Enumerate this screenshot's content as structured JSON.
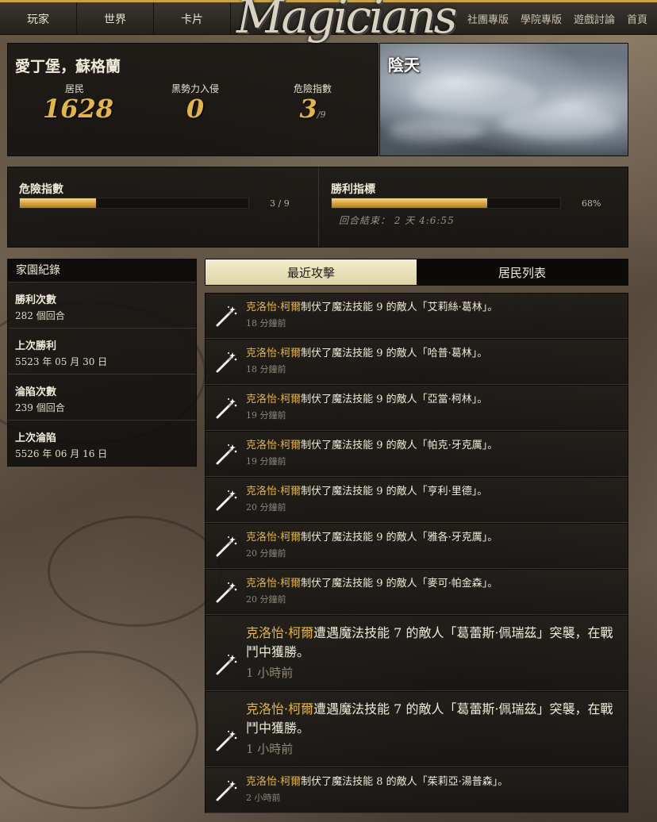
{
  "nav": {
    "left": [
      "玩家",
      "世界",
      "卡片"
    ],
    "logo": "Magicians",
    "right": [
      "社團專版",
      "學院專版",
      "遊戲討論",
      "首頁"
    ]
  },
  "city": {
    "title": "愛丁堡，蘇格蘭",
    "residents_label": "居民",
    "residents_value": "1628",
    "invasion_label": "黑勢力入侵",
    "invasion_value": "0",
    "danger_label": "危險指數",
    "danger_value": "3",
    "danger_max": "/9"
  },
  "weather": {
    "label": "陰天"
  },
  "danger_bar": {
    "title": "危險指數",
    "value_text": "3 / 9",
    "fraction": 0.3333
  },
  "victory_bar": {
    "title": "勝利指標",
    "value_text": "68%",
    "fraction": 0.68,
    "round_end": "回合結束： 2 天 4:6:55"
  },
  "record": {
    "header": "家園紀錄",
    "items": [
      {
        "k": "勝利次數",
        "v": "282 個回合"
      },
      {
        "k": "上次勝利",
        "v": "5523 年 05 月 30 日"
      },
      {
        "k": "淪陷次數",
        "v": "239 個回合"
      },
      {
        "k": "上次淪陷",
        "v": "5526 年 06 月 16 日"
      }
    ]
  },
  "tabs": {
    "recent": "最近攻擊",
    "residents": "居民列表"
  },
  "feed": [
    {
      "size": "small",
      "actor": "克洛怡·柯爾",
      "rest": "制伏了魔法技能 9 的敵人「艾莉絲·葛林」。",
      "time": "18 分鐘前"
    },
    {
      "size": "small",
      "actor": "克洛怡·柯爾",
      "rest": "制伏了魔法技能 9 的敵人「哈普·葛林」。",
      "time": "18 分鐘前"
    },
    {
      "size": "small",
      "actor": "克洛怡·柯爾",
      "rest": "制伏了魔法技能 9 的敵人「亞當·柯林」。",
      "time": "19 分鐘前"
    },
    {
      "size": "small",
      "actor": "克洛怡·柯爾",
      "rest": "制伏了魔法技能 9 的敵人「帕克·牙克厲」。",
      "time": "19 分鐘前"
    },
    {
      "size": "small",
      "actor": "克洛怡·柯爾",
      "rest": "制伏了魔法技能 9 的敵人「亨利·里德」。",
      "time": "20 分鐘前"
    },
    {
      "size": "small",
      "actor": "克洛怡·柯爾",
      "rest": "制伏了魔法技能 9 的敵人「雅各·牙克厲」。",
      "time": "20 分鐘前"
    },
    {
      "size": "small",
      "actor": "克洛怡·柯爾",
      "rest": "制伏了魔法技能 9 的敵人「麥可·帕金森」。",
      "time": "20 分鐘前"
    },
    {
      "size": "big",
      "actor": "克洛怡·柯爾",
      "rest": "遭遇魔法技能 7 的敵人「葛蕾斯·佩瑞茲」突襲，在戰鬥中獲勝。",
      "time": "1 小時前"
    },
    {
      "size": "big",
      "actor": "克洛怡·柯爾",
      "rest": "遭遇魔法技能 7 的敵人「葛蕾斯·佩瑞茲」突襲，在戰鬥中獲勝。",
      "time": "1 小時前"
    },
    {
      "size": "small",
      "actor": "克洛怡·柯爾",
      "rest": "制伏了魔法技能 8 的敵人「茱莉亞·湯普森」。",
      "time": "2 小時前"
    }
  ],
  "colors": {
    "gold": "#e3b548",
    "accent_bar": "#d4a23c",
    "panel": "#161412"
  },
  "icons": {
    "feed": "magic-wand-icon"
  }
}
